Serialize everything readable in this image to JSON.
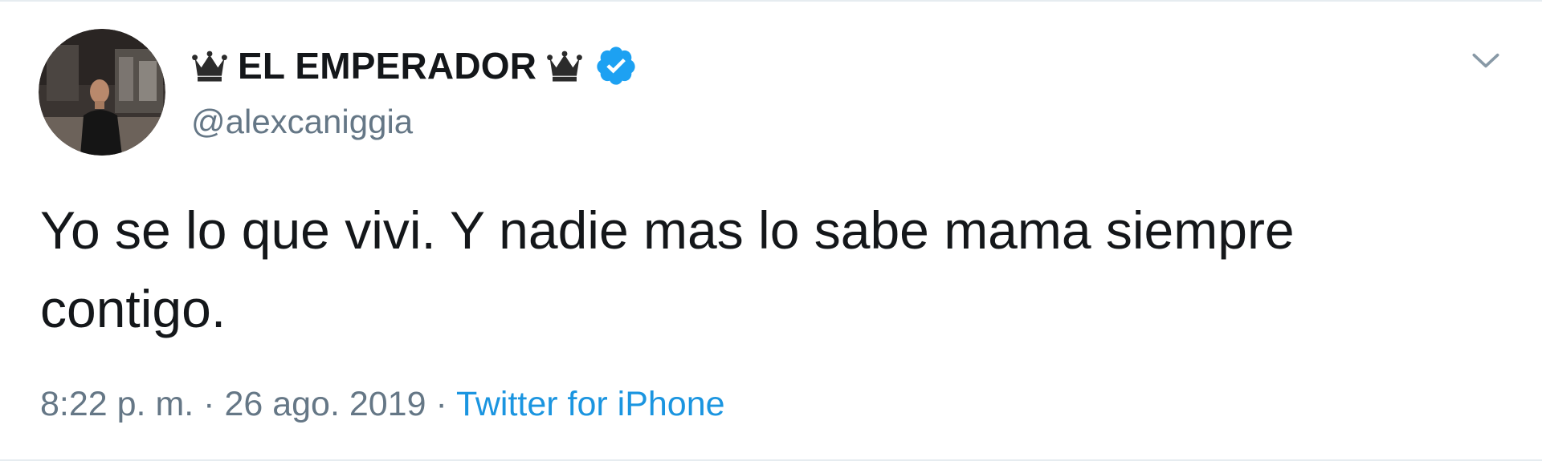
{
  "tweet": {
    "display_name": "EL EMPERADOR",
    "handle": "@alexcaniggia",
    "text": "Yo se lo que vivi. Y nadie mas lo sabe mama siempre contigo.",
    "time": "8:22 p. m.",
    "separator1": " · ",
    "date": "26 ago. 2019",
    "separator2": " · ",
    "source": "Twitter for iPhone"
  },
  "icons": {
    "crown_left": "crown-icon",
    "crown_right": "crown-icon",
    "verified": "verified-badge-icon",
    "caret": "chevron-down-icon"
  },
  "colors": {
    "text": "#14171a",
    "secondary": "#657786",
    "link": "#1b95e0",
    "verified": "#1da1f2"
  }
}
